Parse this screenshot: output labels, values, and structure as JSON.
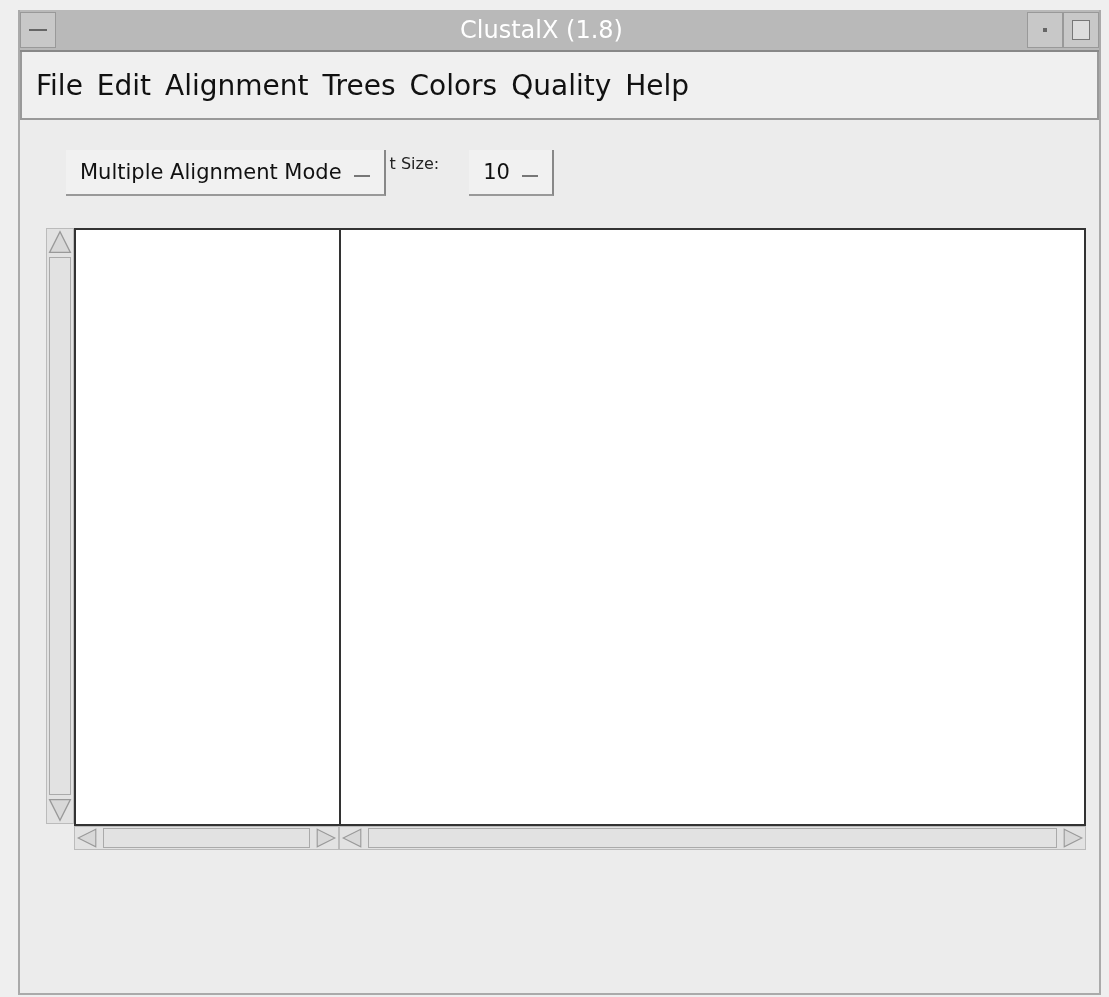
{
  "window": {
    "title": "ClustalX (1.8)"
  },
  "menu": [
    {
      "label": "File"
    },
    {
      "label": "Edit"
    },
    {
      "label": "Alignment"
    },
    {
      "label": "Trees"
    },
    {
      "label": "Colors"
    },
    {
      "label": "Quality"
    },
    {
      "label": "Help"
    }
  ],
  "toolbar": {
    "mode_dropdown": {
      "value": "Multiple Alignment Mode"
    },
    "font_size_label": "t Size:",
    "font_size_dropdown": {
      "value": "10"
    }
  }
}
